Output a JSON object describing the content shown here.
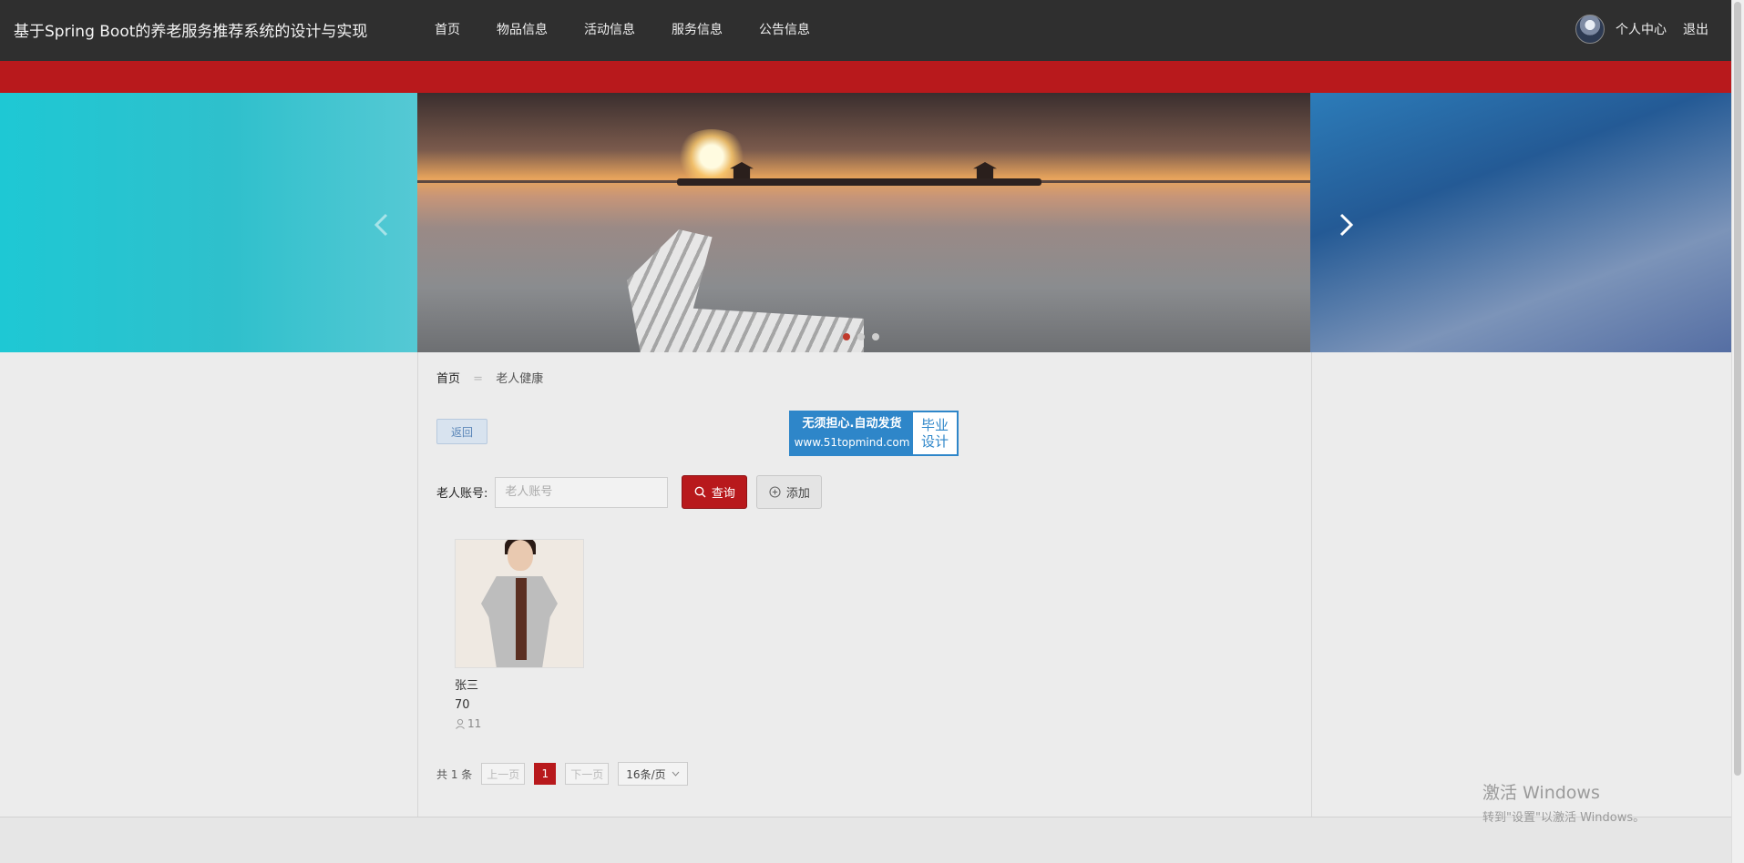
{
  "header": {
    "site_title": "基于Spring Boot的养老服务推荐系统的设计与实现",
    "nav": [
      "首页",
      "物品信息",
      "活动信息",
      "服务信息",
      "公告信息"
    ],
    "user_center": "个人中心",
    "logout": "退出"
  },
  "breadcrumb": {
    "home": "首页",
    "separator": "=",
    "current": "老人健康"
  },
  "back_button": "返回",
  "ad": {
    "line1": "无须担心.自动发货",
    "line2": "www.51topmind.com",
    "right_line1": "毕业",
    "right_line2": "设计"
  },
  "search": {
    "label": "老人账号:",
    "placeholder": "老人账号",
    "query": "查询",
    "add": "添加"
  },
  "cards": [
    {
      "name": "张三",
      "age": "70",
      "views": "11"
    }
  ],
  "pager": {
    "total": "共 1 条",
    "prev": "上一页",
    "current": "1",
    "next": "下一页",
    "page_size": "16条/页"
  },
  "watermark": {
    "line1": "激活 Windows",
    "line2": "转到\"设置\"以激活 Windows。"
  },
  "colors": {
    "header": "#2f2f2f",
    "accent": "#b8191c",
    "ad_blue": "#2e86c9"
  }
}
